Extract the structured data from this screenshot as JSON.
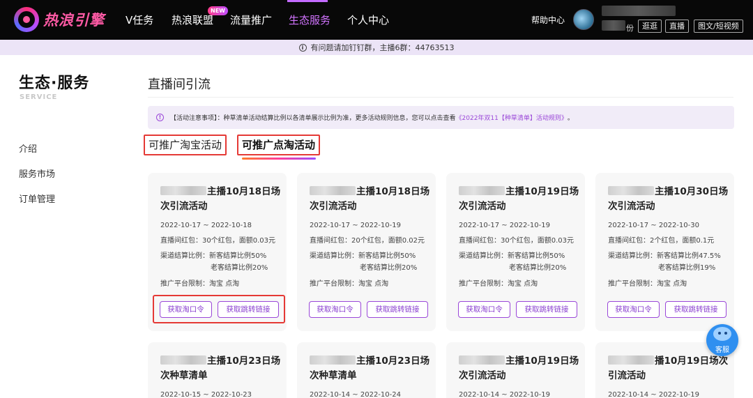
{
  "header": {
    "logo_text": "热浪引擎",
    "nav": [
      {
        "label": "V任务"
      },
      {
        "label": "热浪联盟",
        "badge": "NEW"
      },
      {
        "label": "流量推广"
      },
      {
        "label": "生态服务",
        "active": true
      },
      {
        "label": "个人中心"
      }
    ],
    "help_label": "帮助中心",
    "role_suffix": "份",
    "role_chips": [
      "逛逛",
      "直播",
      "图文/短视频"
    ]
  },
  "notice": {
    "text": "有问题请加钉钉群，主播6群：44763513"
  },
  "sidebar": {
    "title": "生态·服务",
    "subtitle": "SERVICE",
    "items": [
      {
        "label": "介绍"
      },
      {
        "label": "服务市场"
      },
      {
        "label": "订单管理"
      }
    ]
  },
  "main": {
    "title": "直播间引流",
    "rules": {
      "prefix": "【活动注意事项】：种草清单活动结算比例以各清单展示比例为准，更多活动规则信息，您可以点击查看",
      "link": "《2022年双11【种草清单】活动规则》",
      "suffix": "。"
    },
    "tabs": [
      {
        "label": "可推广淘宝活动"
      },
      {
        "label": "可推广点淘活动",
        "active": true
      }
    ],
    "button_taokouling": "获取淘口令",
    "button_link": "获取跳转链接",
    "cards": [
      {
        "title": "主播10月18日场次引流活动",
        "date": "2022-10-17 ~ 2022-10-18",
        "red_packet": "直播间红包：30个红包，面额0.03元",
        "ratio_new": "渠道结算比例：新客结算比例50%",
        "ratio_old": "老客结算比例20%",
        "platform": "推广平台限制：淘宝  点淘"
      },
      {
        "title": "主播10月18日场次引流活动",
        "date": "2022-10-17 ~ 2022-10-19",
        "red_packet": "直播间红包：20个红包，面额0.02元",
        "ratio_new": "渠道结算比例：新客结算比例50%",
        "ratio_old": "老客结算比例20%",
        "platform": "推广平台限制：淘宝  点淘"
      },
      {
        "title": "主播10月19日场次引流活动",
        "date": "2022-10-17 ~ 2022-10-19",
        "red_packet": "直播间红包：30个红包，面额0.03元",
        "ratio_new": "渠道结算比例：新客结算比例50%",
        "ratio_old": "老客结算比例20%",
        "platform": "推广平台限制：淘宝  点淘"
      },
      {
        "title": "主播10月30日场次引流活动",
        "date": "2022-10-17 ~ 2022-10-30",
        "red_packet": "直播间红包：2个红包，面额0.1元",
        "ratio_new": "渠道结算比例：新客结算比例47.5%",
        "ratio_old": "老客结算比例19%",
        "platform": "推广平台限制：淘宝  点淘"
      },
      {
        "title": "主播10月23日场次种草清单",
        "date": "2022-10-15 ~ 2022-10-23"
      },
      {
        "title": "主播10月23日场次种草清单",
        "date": "2022-10-14 ~ 2022-10-24"
      },
      {
        "title": "主播10月19日场次引流活动",
        "date": "2022-10-14 ~ 2022-10-19"
      },
      {
        "title": "播10月19日场次引流活动",
        "date": "2022-10-14 ~ 2022-10-19"
      }
    ]
  },
  "customer_service": {
    "label": "客服"
  },
  "colors": {
    "accent": "#9a47d8",
    "nav_active": "#d274ff",
    "highlight_box": "#e53935"
  }
}
